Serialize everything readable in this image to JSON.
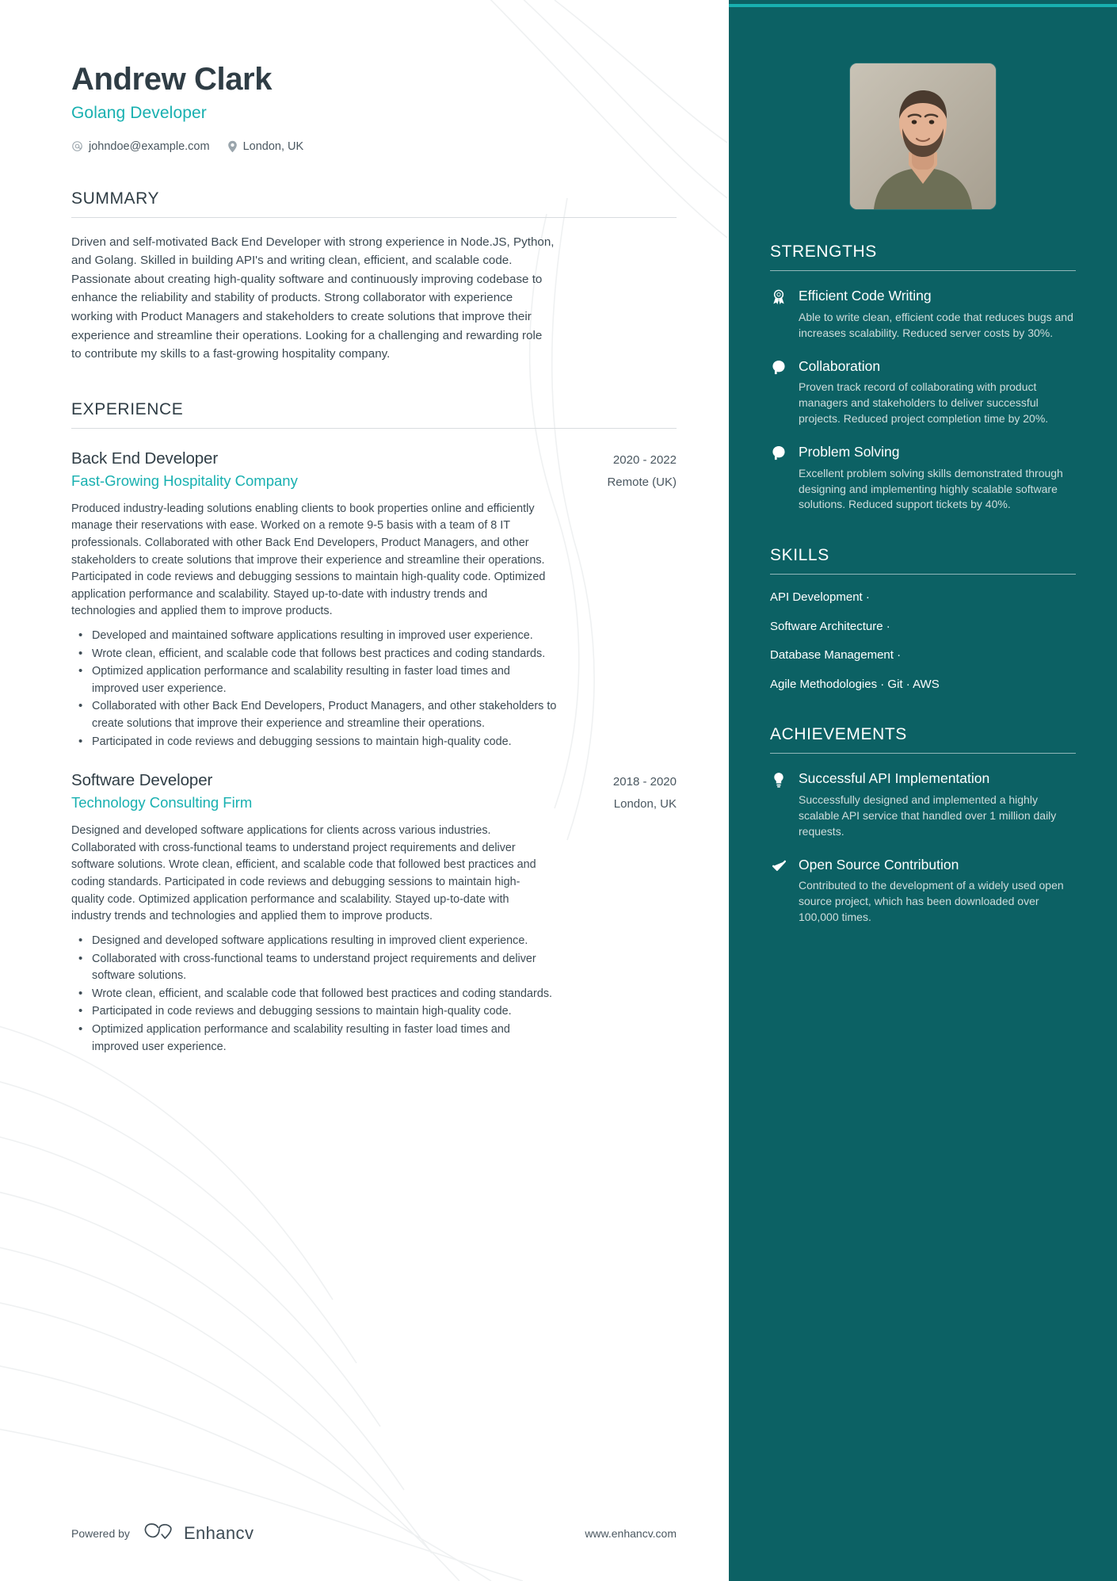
{
  "colors": {
    "accent_teal": "#18b0b0",
    "sidebar_bg": "#0c6164",
    "heading_dark": "#2f3d45",
    "body_text": "#3d4b54",
    "sidebar_body_text": "#cfdddc"
  },
  "header": {
    "name": "Andrew Clark",
    "job_title": "Golang Developer",
    "email": "johndoe@example.com",
    "location": "London, UK",
    "email_icon": "at-sign-icon",
    "location_icon": "map-pin-icon"
  },
  "summary": {
    "heading": "SUMMARY",
    "text": "Driven and self-motivated Back End Developer with strong experience in Node.JS, Python, and Golang. Skilled in building API's and writing clean, efficient, and scalable code. Passionate about creating high-quality software and continuously improving codebase to enhance the reliability and stability of products. Strong collaborator with experience working with Product Managers and stakeholders to create solutions that improve their experience and streamline their operations. Looking for a challenging and rewarding role to contribute my skills to a fast-growing hospitality company."
  },
  "experience": {
    "heading": "EXPERIENCE",
    "entries": [
      {
        "role": "Back End Developer",
        "dates": "2020 - 2022",
        "company": "Fast-Growing Hospitality Company",
        "location": "Remote (UK)",
        "description": "Produced industry-leading solutions enabling clients to book properties online and efficiently manage their reservations with ease. Worked on a remote 9-5 basis with a team of 8 IT professionals. Collaborated with other Back End Developers, Product Managers, and other stakeholders to create solutions that improve their experience and streamline their operations. Participated in code reviews and debugging sessions to maintain high-quality code. Optimized application performance and scalability. Stayed up-to-date with industry trends and technologies and applied them to improve products.",
        "bullets": [
          "Developed and maintained software applications resulting in improved user experience.",
          "Wrote clean, efficient, and scalable code that follows best practices and coding standards.",
          "Optimized application performance and scalability resulting in faster load times and improved user experience.",
          "Collaborated with other Back End Developers, Product Managers, and other stakeholders to create solutions that improve their experience and streamline their operations.",
          "Participated in code reviews and debugging sessions to maintain high-quality code."
        ]
      },
      {
        "role": "Software Developer",
        "dates": "2018 - 2020",
        "company": "Technology Consulting Firm",
        "location": "London, UK",
        "description": "Designed and developed software applications for clients across various industries. Collaborated with cross-functional teams to understand project requirements and deliver software solutions. Wrote clean, efficient, and scalable code that followed best practices and coding standards. Participated in code reviews and debugging sessions to maintain high-quality code. Optimized application performance and scalability. Stayed up-to-date with industry trends and technologies and applied them to improve products.",
        "bullets": [
          "Designed and developed software applications resulting in improved client experience.",
          "Collaborated with cross-functional teams to understand project requirements and deliver software solutions.",
          "Wrote clean, efficient, and scalable code that followed best practices and coding standards.",
          "Participated in code reviews and debugging sessions to maintain high-quality code.",
          "Optimized application performance and scalability resulting in faster load times and improved user experience."
        ]
      }
    ]
  },
  "strengths": {
    "heading": "STRENGTHS",
    "items": [
      {
        "icon": "award-ribbon-icon",
        "title": "Efficient Code Writing",
        "text": "Able to write clean, efficient code that reduces bugs and increases scalability. Reduced server costs by 30%."
      },
      {
        "icon": "head-profile-icon",
        "title": "Collaboration",
        "text": "Proven track record of collaborating with product managers and stakeholders to deliver successful projects. Reduced project completion time by 20%."
      },
      {
        "icon": "head-profile-icon",
        "title": "Problem Solving",
        "text": "Excellent problem solving skills demonstrated through designing and implementing highly scalable software solutions. Reduced support tickets by 40%."
      }
    ]
  },
  "skills": {
    "heading": "SKILLS",
    "rows": [
      "API Development ·",
      "Software Architecture ·",
      "Database Management ·",
      "Agile Methodologies · Git · AWS"
    ]
  },
  "achievements": {
    "heading": "ACHIEVEMENTS",
    "items": [
      {
        "icon": "lightbulb-icon",
        "title": "Successful API Implementation",
        "text": "Successfully designed and implemented a highly scalable API service that handled over 1 million daily requests."
      },
      {
        "icon": "checkmark-icon",
        "title": "Open Source Contribution",
        "text": "Contributed to the development of a widely used open source project, which has been downloaded over 100,000 times."
      }
    ]
  },
  "footer": {
    "powered_by": "Powered by",
    "brand": "Enhancv",
    "brand_icon": "enhancv-logo-icon",
    "website": "www.enhancv.com"
  }
}
